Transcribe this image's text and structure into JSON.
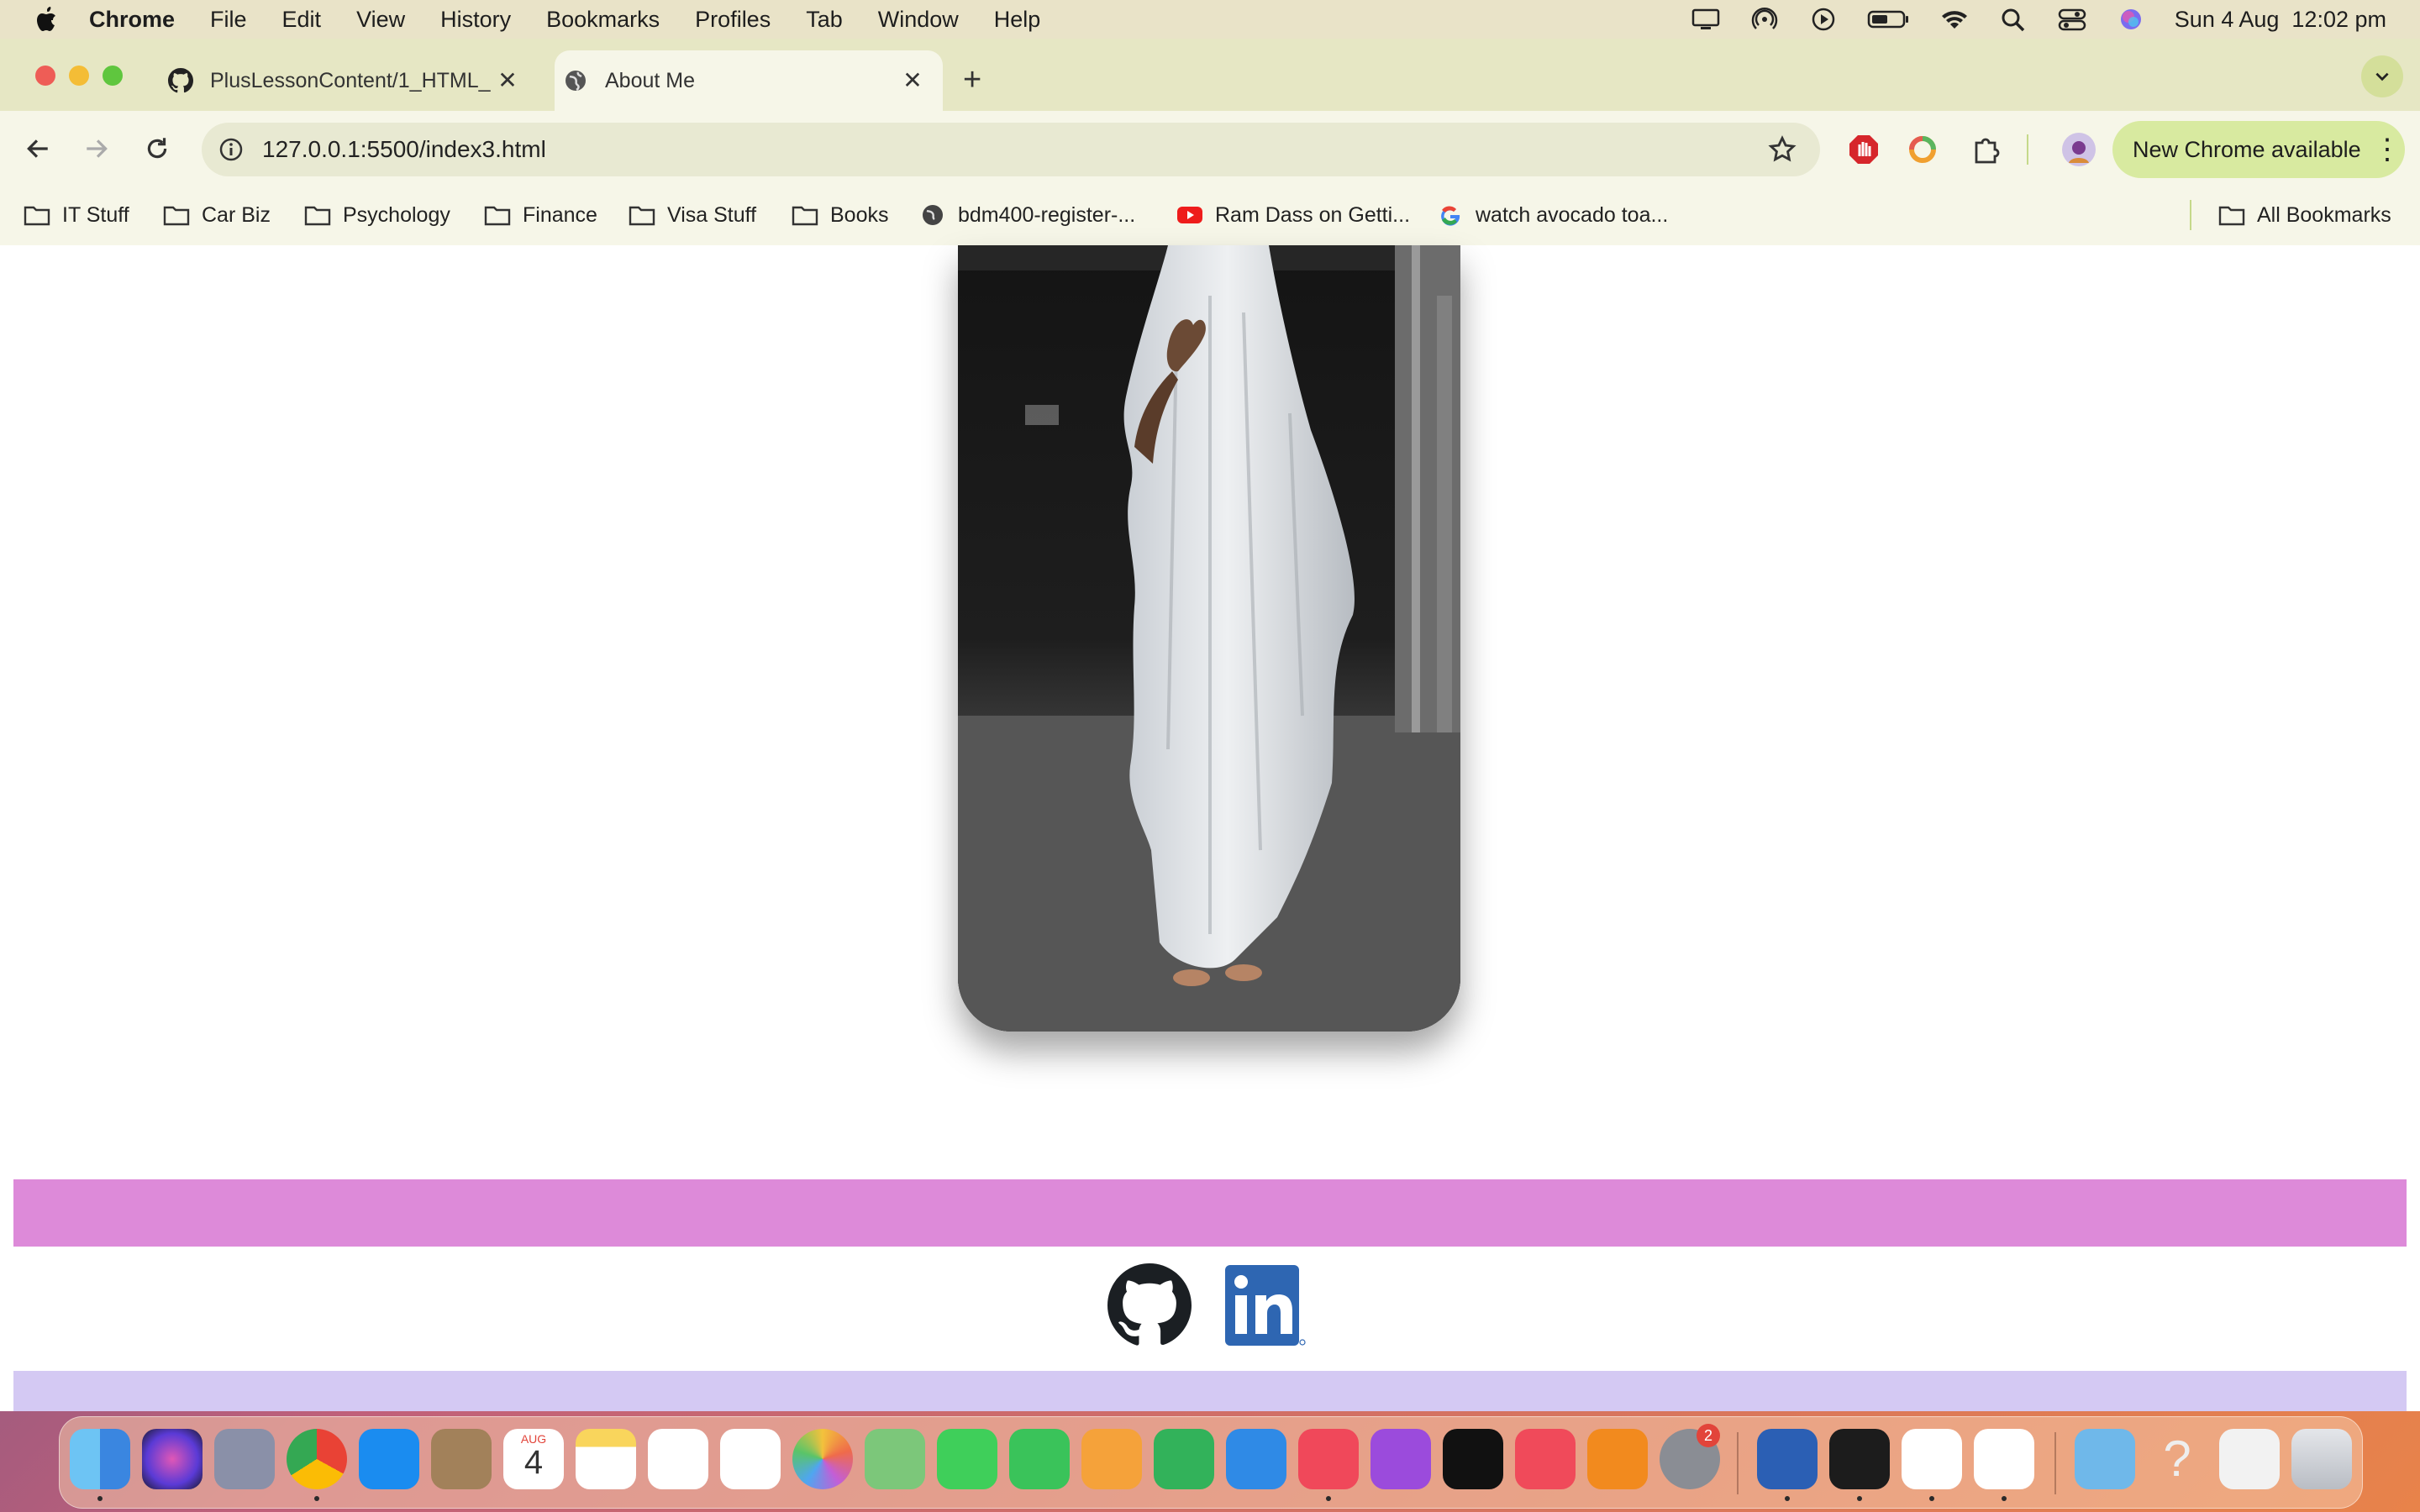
{
  "menubar": {
    "app": "Chrome",
    "items": [
      "File",
      "Edit",
      "View",
      "History",
      "Bookmarks",
      "Profiles",
      "Tab",
      "Window",
      "Help"
    ],
    "datetime": "Sun 4 Aug  12:02 pm"
  },
  "tabs": [
    {
      "title": "PlusLessonContent/1_HTML_",
      "favicon": "github-icon",
      "active": false
    },
    {
      "title": "About Me",
      "favicon": "globe-icon",
      "active": true
    }
  ],
  "toolbar": {
    "url": "127.0.0.1:5500/index3.html",
    "update_label": "New Chrome available"
  },
  "bookmarks": [
    {
      "label": "IT Stuff",
      "icon": "folder-icon"
    },
    {
      "label": "Car Biz",
      "icon": "folder-icon"
    },
    {
      "label": "Psychology",
      "icon": "folder-icon"
    },
    {
      "label": "Finance",
      "icon": "folder-icon"
    },
    {
      "label": "Visa Stuff",
      "icon": "folder-icon"
    },
    {
      "label": "Books",
      "icon": "folder-icon"
    },
    {
      "label": "bdm400-register-...",
      "icon": "globe-icon"
    },
    {
      "label": "Ram Dass on Getti...",
      "icon": "youtube-icon"
    },
    {
      "label": "watch avocado toa...",
      "icon": "google-icon"
    }
  ],
  "all_bookmarks": "All Bookmarks",
  "page": {
    "photo": "ghost-sheet-photo",
    "social": [
      "github-icon",
      "linkedin-icon"
    ],
    "band_colors": {
      "pink": "#dd8ad9",
      "lavender": "#d4c9f3"
    }
  },
  "dock": {
    "calendar_month": "AUG",
    "calendar_day": "4",
    "settings_badge": "2"
  }
}
